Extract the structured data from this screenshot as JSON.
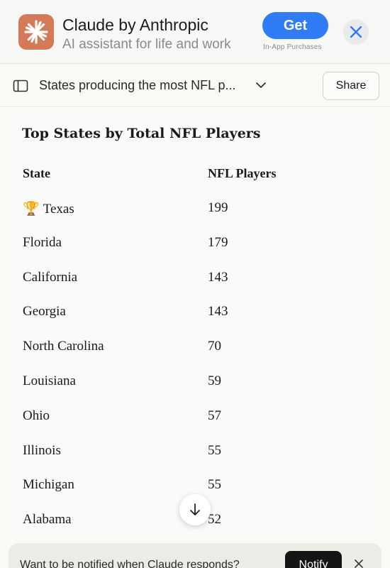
{
  "app_banner": {
    "title": "Claude by Anthropic",
    "subtitle": "AI assistant for life and work",
    "get_label": "Get",
    "in_app_label": "In-App Purchases",
    "icon_color": "#d37a58",
    "get_color": "#2f7cf6"
  },
  "header": {
    "conversation_title": "States producing the most NFL p...",
    "share_label": "Share"
  },
  "table": {
    "title": "Top States by Total NFL Players",
    "columns": [
      "State",
      "NFL Players"
    ],
    "rows": [
      {
        "state": "Texas",
        "players": "199",
        "badge": "🏆"
      },
      {
        "state": "Florida",
        "players": "179"
      },
      {
        "state": "California",
        "players": "143"
      },
      {
        "state": "Georgia",
        "players": "143"
      },
      {
        "state": "North Carolina",
        "players": "70"
      },
      {
        "state": "Louisiana",
        "players": "59"
      },
      {
        "state": "Ohio",
        "players": "57"
      },
      {
        "state": "Illinois",
        "players": "55"
      },
      {
        "state": "Michigan",
        "players": "55"
      },
      {
        "state": "Alabama",
        "players": "52"
      }
    ]
  },
  "notify": {
    "text": "Want to be notified when Claude responds?",
    "button_label": "Notify"
  }
}
